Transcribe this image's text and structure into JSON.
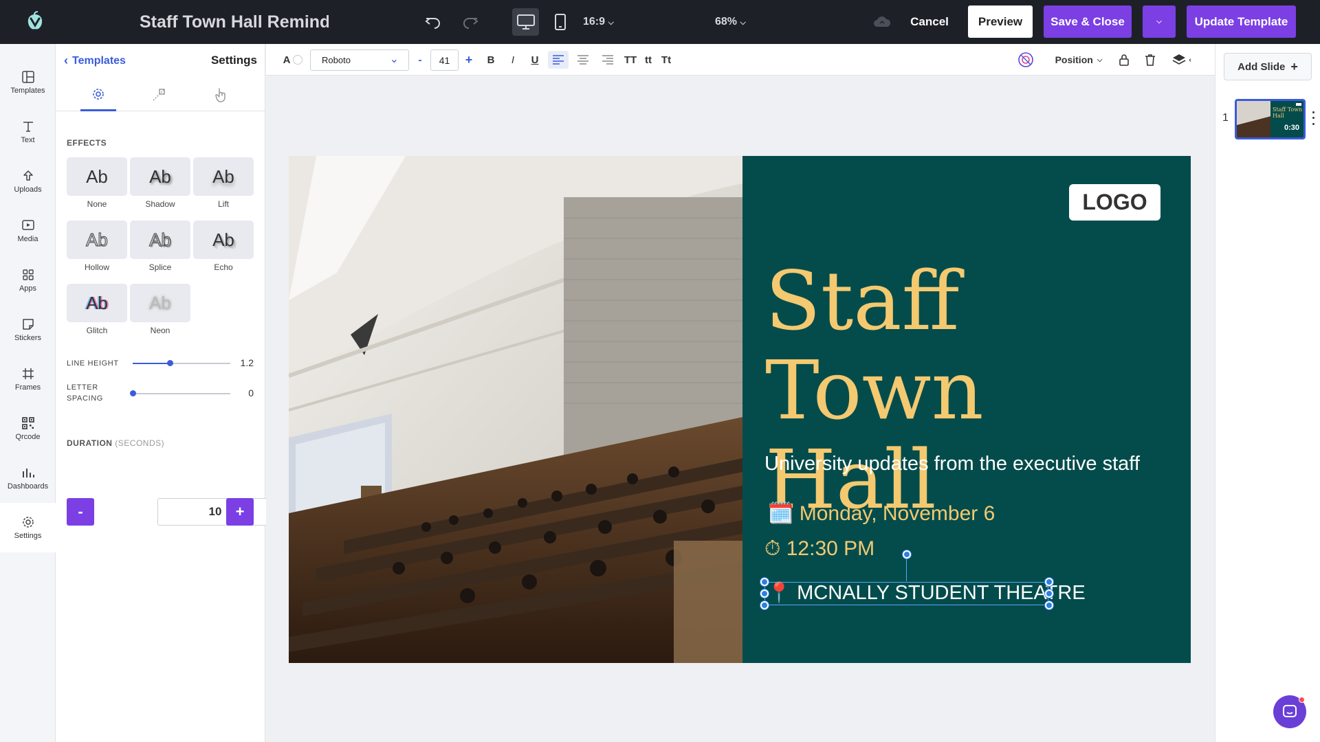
{
  "topbar": {
    "doc_title": "Staff Town Hall Reminde",
    "aspect_ratio": "16:9",
    "zoom": "68%",
    "cancel": "Cancel",
    "preview": "Preview",
    "save_close": "Save & Close",
    "update_template": "Update Template"
  },
  "rail": [
    {
      "label": "Templates",
      "icon": "templates-icon"
    },
    {
      "label": "Text",
      "icon": "text-icon"
    },
    {
      "label": "Uploads",
      "icon": "upload-icon"
    },
    {
      "label": "Media",
      "icon": "media-icon"
    },
    {
      "label": "Apps",
      "icon": "apps-icon"
    },
    {
      "label": "Stickers",
      "icon": "sticker-icon"
    },
    {
      "label": "Frames",
      "icon": "frames-icon"
    },
    {
      "label": "Qrcode",
      "icon": "qrcode-icon"
    },
    {
      "label": "Dashboards",
      "icon": "dashboards-icon"
    },
    {
      "label": "Settings",
      "icon": "settings-icon"
    }
  ],
  "panel": {
    "back_label": "Templates",
    "title": "Settings",
    "effects_label": "EFFECTS",
    "effects": [
      "None",
      "Shadow",
      "Lift",
      "Hollow",
      "Splice",
      "Echo",
      "Glitch",
      "Neon"
    ],
    "effect_sample": "Ab",
    "line_height_label": "LINE HEIGHT",
    "line_height_value": "1.2",
    "line_height_fraction": 0.38,
    "letter_spacing_label": "LETTER SPACING",
    "letter_spacing_value": "0",
    "letter_spacing_fraction": 0.0,
    "duration_label": "DURATION",
    "duration_unit": "(SECONDS)",
    "duration_value": "10",
    "minus": "-",
    "plus": "+"
  },
  "format": {
    "font": "Roboto",
    "size": "41",
    "minus": "-",
    "plus": "+",
    "bold": "B",
    "italic": "I",
    "underline": "U",
    "upper": "TT",
    "lower": "tt",
    "title_case": "Tt",
    "text_color_glyph": "A",
    "position": "Position"
  },
  "slide": {
    "logo": "LOGO",
    "title_line1": "Staff",
    "title_line2": "Town Hall",
    "subtitle": "University updates from the executive staff",
    "date_icon": "🗓️",
    "date": "Monday, November 6",
    "time_icon": "⏱",
    "time": "12:30 PM",
    "location_icon": "📍",
    "location": "MCNALLY STUDENT THEATRE",
    "colors": {
      "panel": "#044c4c",
      "title": "#f4c970",
      "date": "#f4c970",
      "text": "#ffffff"
    }
  },
  "right_panel": {
    "add_slide": "Add Slide",
    "slide_number": "1",
    "thumb_time": "0:30",
    "thumb_title": "Staff Town Hall"
  },
  "accent": "#7b3fe4"
}
